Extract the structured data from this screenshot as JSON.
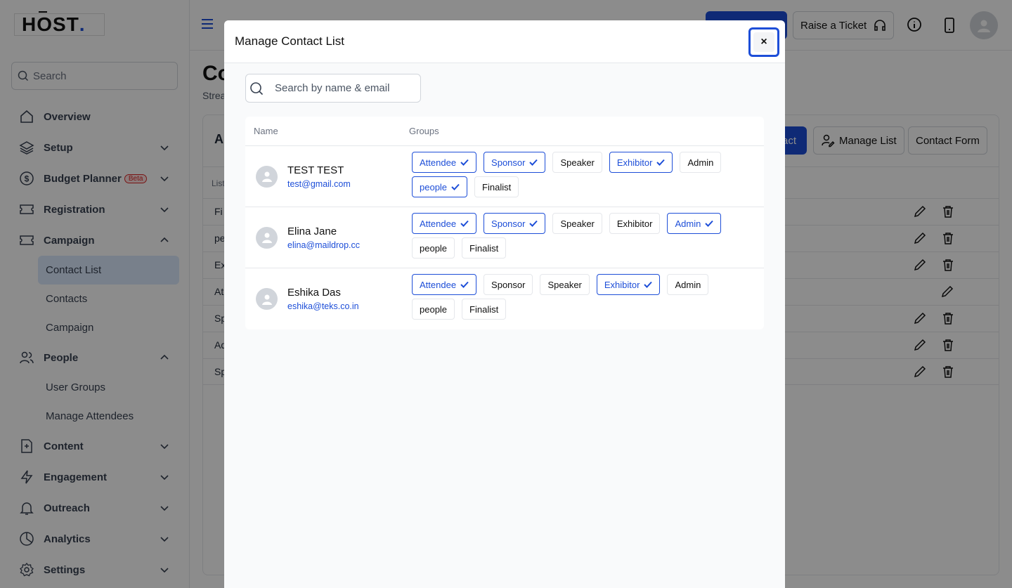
{
  "sidebar": {
    "logo": "HOST",
    "search_placeholder": "Search",
    "items": [
      {
        "label": "Overview",
        "icon": "home-icon"
      },
      {
        "label": "Setup",
        "icon": "layers-icon"
      },
      {
        "label": "Budget Planner",
        "badge": "Beta",
        "icon": "dollar-icon"
      },
      {
        "label": "Registration",
        "icon": "ticket-icon"
      },
      {
        "label": "Campaign",
        "icon": "ticket-icon"
      },
      {
        "label": "People",
        "icon": "users-icon"
      },
      {
        "label": "Content",
        "icon": "document-icon"
      },
      {
        "label": "Engagement",
        "icon": "bolt-icon"
      },
      {
        "label": "Outreach",
        "icon": "bell-icon"
      },
      {
        "label": "Analytics",
        "icon": "pie-chart-icon"
      },
      {
        "label": "Settings",
        "icon": "gear-icon"
      }
    ],
    "campaign_sub": [
      "Contact List",
      "Contacts",
      "Campaign"
    ],
    "people_sub": [
      "User Groups",
      "Manage Attendees"
    ]
  },
  "topbar": {
    "ticket_label": "Raise a Ticket"
  },
  "page": {
    "title": "Co",
    "subtitle": "Strea",
    "card_title": "A",
    "btn_contact": "act",
    "btn_manage_list": "Manage List",
    "btn_contact_form": "Contact Form",
    "list_header": "List",
    "rows": [
      "Fi",
      "pe",
      "Ex",
      "At",
      "Sp",
      "Ad",
      "Sp"
    ]
  },
  "modal": {
    "title": "Manage Contact List",
    "close_label": "×",
    "search_placeholder": "Search by name & email",
    "col_name": "Name",
    "col_groups": "Groups",
    "contacts": [
      {
        "name": "TEST TEST",
        "email": "test@gmail.com",
        "groups": [
          {
            "label": "Attendee",
            "selected": true
          },
          {
            "label": "Sponsor",
            "selected": true
          },
          {
            "label": "Speaker",
            "selected": false
          },
          {
            "label": "Exhibitor",
            "selected": true
          },
          {
            "label": "Admin",
            "selected": false
          },
          {
            "label": "people",
            "selected": true
          },
          {
            "label": "Finalist",
            "selected": false
          }
        ]
      },
      {
        "name": "Elina Jane",
        "email": "elina@maildrop.cc",
        "groups": [
          {
            "label": "Attendee",
            "selected": true
          },
          {
            "label": "Sponsor",
            "selected": true
          },
          {
            "label": "Speaker",
            "selected": false
          },
          {
            "label": "Exhibitor",
            "selected": false
          },
          {
            "label": "Admin",
            "selected": true
          },
          {
            "label": "people",
            "selected": false
          },
          {
            "label": "Finalist",
            "selected": false
          }
        ]
      },
      {
        "name": "Eshika Das",
        "email": "eshika@teks.co.in",
        "groups": [
          {
            "label": "Attendee",
            "selected": true
          },
          {
            "label": "Sponsor",
            "selected": false
          },
          {
            "label": "Speaker",
            "selected": false
          },
          {
            "label": "Exhibitor",
            "selected": true
          },
          {
            "label": "Admin",
            "selected": false
          },
          {
            "label": "people",
            "selected": false
          },
          {
            "label": "Finalist",
            "selected": false
          }
        ]
      }
    ]
  },
  "colors": {
    "accent": "#1d4ed8",
    "overlay": "rgba(0,0,0,0.45)"
  }
}
